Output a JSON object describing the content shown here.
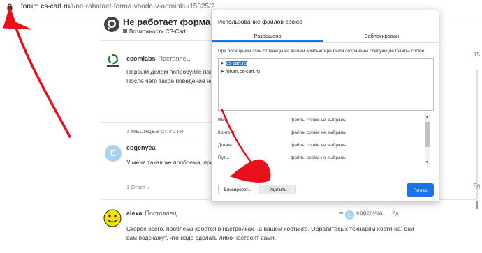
{
  "addressbar": {
    "url_host": "forum.cs-cart.ru",
    "url_path": "/t/ne-rabotaet-forma-vhoda-v-adminku/15825/2",
    "lock_icon": "lock-icon"
  },
  "topic": {
    "title": "Не работает форма вх",
    "category": "Возможности CS-Cart"
  },
  "posts": [
    {
      "author": "ecomlabs",
      "role": "Постоялец",
      "lines": [
        "Первым делом попробуйте папку",
        "После чего такое поведение нача"
      ]
    },
    {
      "author": "ebgenyea",
      "role": "",
      "avatar_letter": "E",
      "lines": [
        "У меня такая же проблема, пробл"
      ],
      "reply_count": "1 Ответ"
    },
    {
      "author": "alexa",
      "role": "Постоялец",
      "lines": [
        "Скорее всего, проблема кроется в настройках на вашем хостинге. Обратитесь к технарям хостинга, они",
        "вам подскажут, что надо сделать либо настроят сами."
      ],
      "reply_to": "ebgenyea",
      "date": "2д"
    }
  ],
  "time_gap": "7 МЕСЯЦЕВ СПУСТЯ",
  "timeline": {
    "top_number": "15",
    "bottom_date": "2д"
  },
  "cookie_dialog": {
    "title": "Использование файлов cookie",
    "tabs": [
      {
        "label": "Разрешено",
        "active": true
      },
      {
        "label": "Заблокирован",
        "active": false
      }
    ],
    "info": "При посещении этой страницы на вашем компьютере были сохранены следующие файлы cookie:",
    "sites": [
      {
        "label": "cs-cart.ru",
        "selected": true
      },
      {
        "label": "forum.cs-cart.ru",
        "selected": false
      }
    ],
    "details": [
      {
        "key": "Имя:",
        "value": "файлы cookie не выбраны"
      },
      {
        "key": "Контент:",
        "value": "файлы cookie не выбраны"
      },
      {
        "key": "Домен:",
        "value": "файлы cookie не выбраны"
      },
      {
        "key": "Путь:",
        "value": "файлы cookie не выбраны"
      }
    ],
    "block_label": "Блокировать",
    "delete_label": "Удалить",
    "done_label": "Готово"
  },
  "colors": {
    "accent": "#1a73e8",
    "annotation": "#e8101b",
    "avatar_e": "#a8d3ee"
  }
}
